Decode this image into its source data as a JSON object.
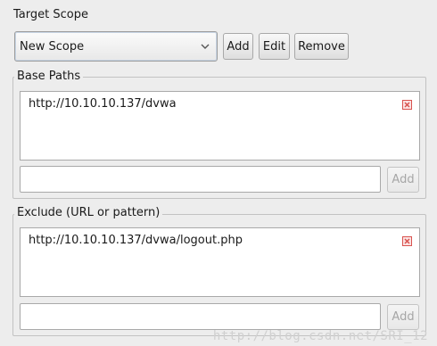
{
  "section_title": "Target Scope",
  "scope": {
    "selected": "New Scope",
    "add_label": "Add",
    "edit_label": "Edit",
    "remove_label": "Remove"
  },
  "base_paths": {
    "legend": "Base Paths",
    "items": [
      "http://10.10.10.137/dvwa"
    ],
    "input_value": "",
    "add_label": "Add"
  },
  "exclude": {
    "legend": "Exclude (URL or pattern)",
    "items": [
      "http://10.10.10.137/dvwa/logout.php"
    ],
    "input_value": "",
    "add_label": "Add"
  },
  "watermark": "http://blog.csdn.net/SRI_12",
  "colors": {
    "delete_icon": "#d9534f",
    "background": "#ededed"
  }
}
